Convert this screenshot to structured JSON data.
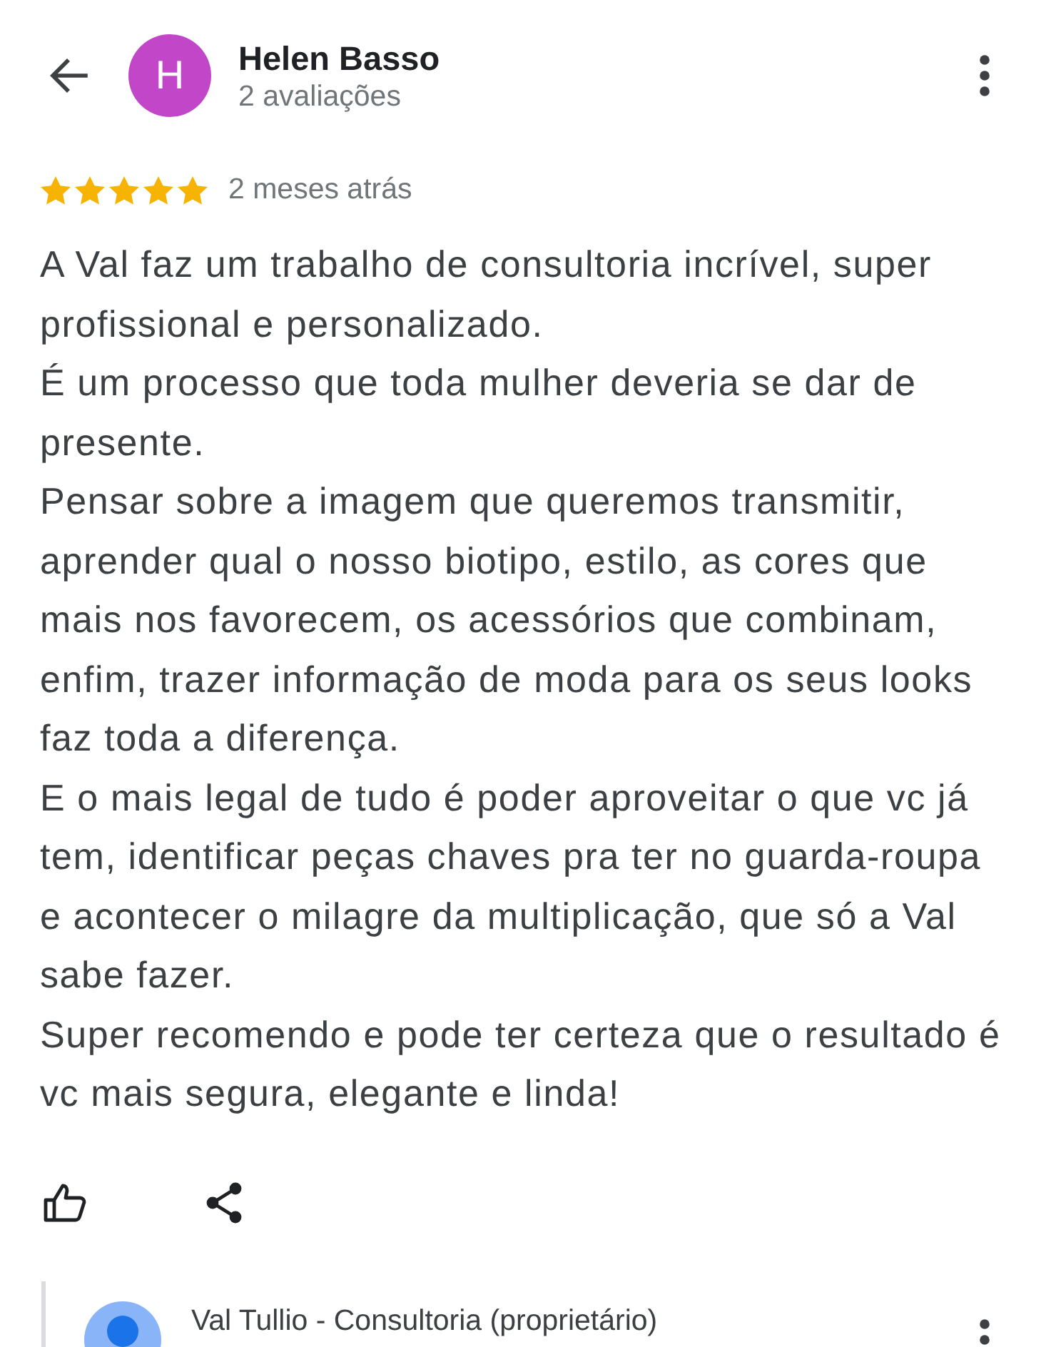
{
  "header": {
    "avatar_letter": "H",
    "author": "Helen Basso",
    "review_count": "2 avaliações"
  },
  "review": {
    "stars": 5,
    "time": "2 meses atrás",
    "text": "A Val faz um trabalho de consultoria incrível, super profissional e personalizado.\nÉ um processo que toda mulher deveria se dar de presente.\nPensar sobre a imagem que queremos transmitir, aprender qual o nosso biotipo, estilo, as cores que mais nos favorecem, os acessórios que combinam, enfim, trazer informação de moda para os seus looks faz toda a diferença.\nE o mais legal de tudo é poder aproveitar o que vc já tem, identificar peças chaves pra ter no guarda-roupa e acontecer o milagre da multiplicação, que só a Val sabe fazer.\nSuper recomendo e pode ter certeza que o resultado é vc mais segura, elegante e linda!"
  },
  "owner_reply": {
    "author": "Val Tullio - Consultoria (proprietário)"
  }
}
